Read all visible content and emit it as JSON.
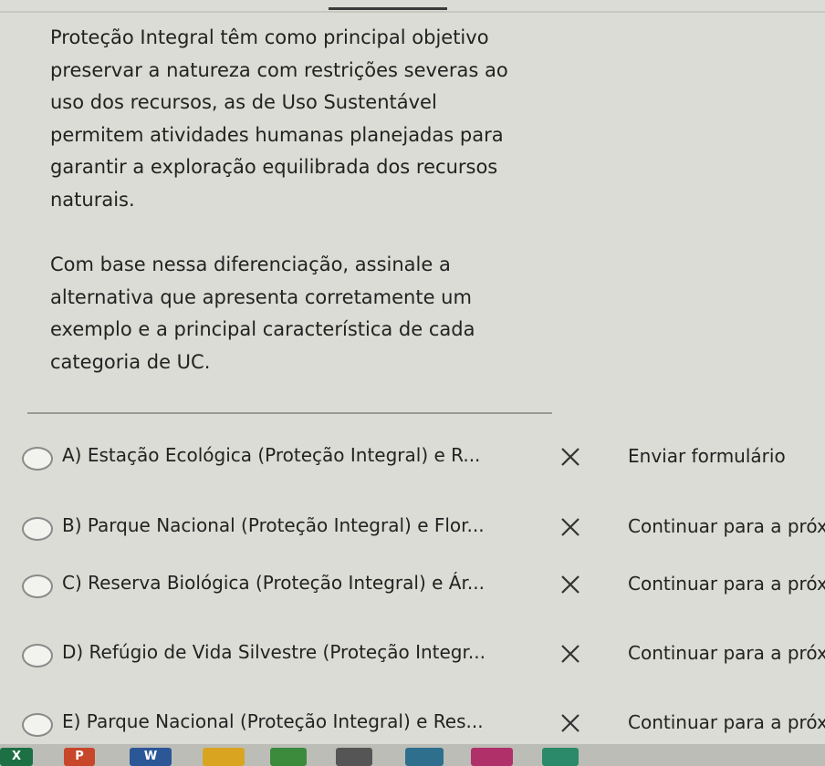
{
  "question": {
    "paragraph1": "Proteção Integral têm como principal objetivo preservar a natureza com restrições severas ao uso dos recursos, as de Uso Sustentável permitem atividades humanas planejadas para garantir a exploração equilibrada dos recursos naturais.",
    "paragraph2": "Com base nessa diferenciação, assinale a alternativa que apresenta corretamente um exemplo e a principal característica de cada categoria de UC."
  },
  "options": [
    {
      "label": "A) Estação Ecológica (Proteção Integral) e R...",
      "action": "Enviar formulário"
    },
    {
      "label": "B) Parque Nacional (Proteção Integral) e Flor...",
      "action": "Continuar para a próxi"
    },
    {
      "label": "C) Reserva Biológica (Proteção Integral) e Ár...",
      "action": "Continuar para a próxi"
    },
    {
      "label": "D) Refúgio de Vida Silvestre (Proteção Integr...",
      "action": "Continuar para a próxi"
    },
    {
      "label": "E) Parque Nacional (Proteção Integral) e Res...",
      "action": "Continuar para a próxi"
    }
  ],
  "taskbar": {
    "icons": [
      {
        "name": "excel-icon",
        "glyph": "X",
        "color": "#1d7044"
      },
      {
        "name": "powerpoint-icon",
        "glyph": "P",
        "color": "#c8462a"
      },
      {
        "name": "word-icon",
        "glyph": "W",
        "color": "#2b5797"
      },
      {
        "name": "folder-icon",
        "glyph": "",
        "color": "#d9a520"
      },
      {
        "name": "chrome-icon",
        "glyph": "",
        "color": "#3c8a3c"
      },
      {
        "name": "media-icon",
        "glyph": "",
        "color": "#555555"
      },
      {
        "name": "app-icon",
        "glyph": "",
        "color": "#2e6f8e"
      },
      {
        "name": "browser-icon",
        "glyph": "",
        "color": "#b0306a"
      },
      {
        "name": "store-icon",
        "glyph": "",
        "color": "#2a8a6a"
      }
    ]
  }
}
